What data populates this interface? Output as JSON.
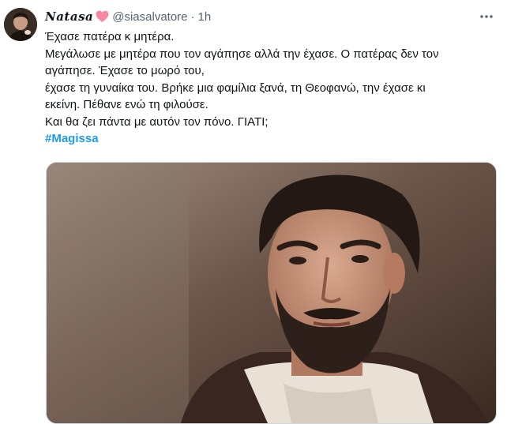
{
  "tweet": {
    "display_name": "Natasa",
    "name_emoji": "pink-heart-icon",
    "handle": "@siasalvatore",
    "separator": "·",
    "time": "1h",
    "more_icon": "more-icon",
    "lines": [
      "Έχασε πατέρα κ μητέρα.",
      "Μεγάλωσε με μητέρα που τον αγάπησε αλλά την έχασε. Ο πατέρας δεν τον",
      "αγάπησε. Έχασε το μωρό του,",
      "έχασε τη γυναίκα του. Βρήκε μια φαμίλια ξανά, τη Θεοφανώ, την έχασε κι",
      "εκείνη. Πέθανε ενώ τη φιλούσε.",
      "Και θα ζει πάντα με αυτόν τον πόνο. ΓΙΑΤΙ;"
    ],
    "hashtag": "#Magissa",
    "colors": {
      "text": "#0f1419",
      "secondary": "#536471",
      "link": "#1d9bf0",
      "heart": "#f4899f"
    }
  }
}
